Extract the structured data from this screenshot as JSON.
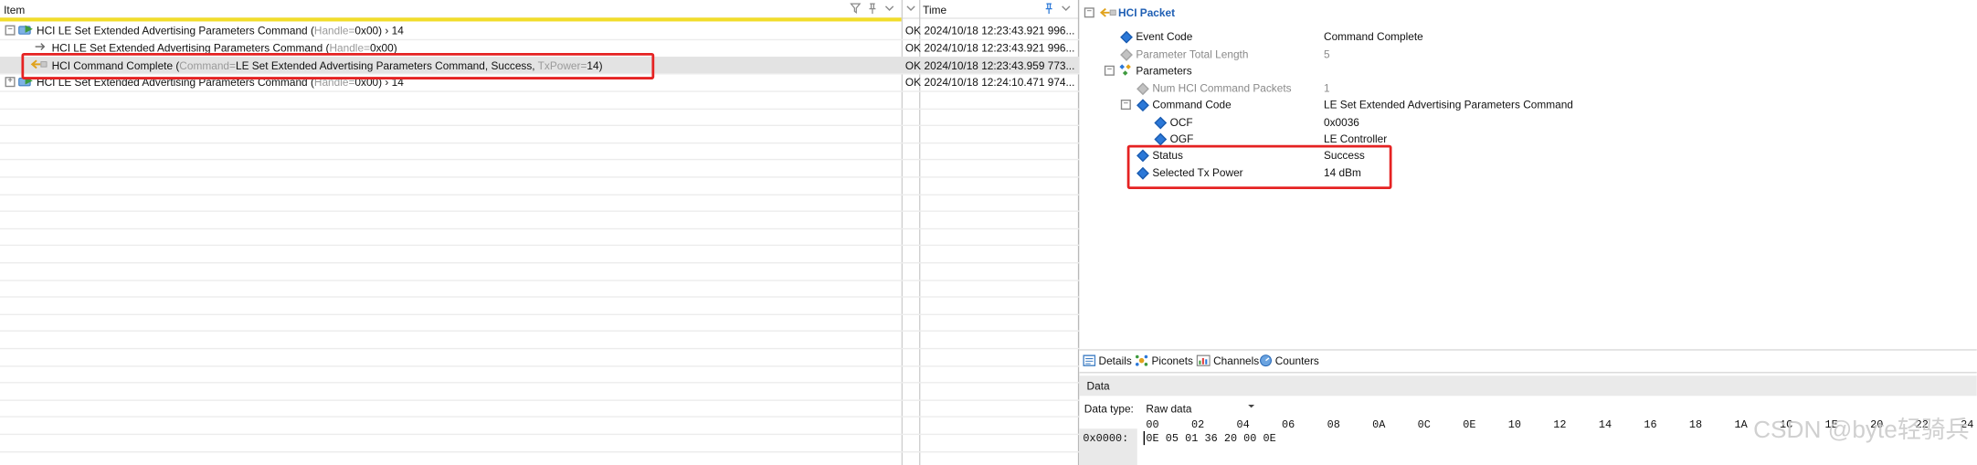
{
  "list_header": {
    "item": "Item",
    "status_col": "",
    "time": "Time"
  },
  "rows": [
    {
      "name": "HCI LE Set Extended Advertising Parameters Command",
      "open_paren": " (",
      "field1_key": "Handle",
      "field1_eq": "=",
      "field1_val": "0x00)",
      "tail": " › 14",
      "status": "OK",
      "time": "2024/10/18 12:23:43.921 996..."
    },
    {
      "name": "HCI LE Set Extended Advertising Parameters Command",
      "open_paren": " (",
      "field1_key": "Handle",
      "field1_eq": "=",
      "field1_val": "0x00)",
      "tail": "",
      "status": "OK",
      "time": "2024/10/18 12:23:43.921 996..."
    },
    {
      "name": "HCI Command Complete",
      "open_paren": " (",
      "field1_key": "Command",
      "field1_eq": "=",
      "field1_val": "LE Set Extended Advertising Parameters Command, Success, ",
      "field2_key": "TxPower",
      "field2_eq": "=",
      "field2_val": "14)",
      "tail": "",
      "status": "OK",
      "time": "2024/10/18 12:23:43.959 773..."
    },
    {
      "name": "HCI LE Set Extended Advertising Parameters Command",
      "open_paren": " (",
      "field1_key": "Handle",
      "field1_eq": "=",
      "field1_val": "0x00)",
      "tail": " › 14",
      "status": "OK",
      "time": "2024/10/18 12:24:10.471 974..."
    }
  ],
  "details": {
    "title": "HCI Packet",
    "event_code_label": "Event Code",
    "event_code_value": "Command Complete",
    "param_len_label": "Parameter Total Length",
    "param_len_value": "5",
    "parameters_label": "Parameters",
    "num_packets_label": "Num HCI Command Packets",
    "num_packets_value": "1",
    "command_code_label": "Command Code",
    "command_code_value": "LE Set Extended Advertising Parameters Command",
    "ocf_label": "OCF",
    "ocf_value": "0x0036",
    "ogf_label": "OGF",
    "ogf_value": "LE Controller",
    "status_label": "Status",
    "status_value": "Success",
    "txpower_label": "Selected Tx Power",
    "txpower_value": "14 dBm"
  },
  "tabs": [
    {
      "label": "Details"
    },
    {
      "label": "Piconets"
    },
    {
      "label": "Channels"
    },
    {
      "label": "Counters"
    }
  ],
  "data_panel": {
    "title": "Data",
    "type_label": "Data type:",
    "type_value": "Raw data",
    "offsets": [
      "00",
      "02",
      "04",
      "06",
      "08",
      "0A",
      "0C",
      "0E",
      "10",
      "12",
      "14",
      "16",
      "18",
      "1A",
      "1C",
      "1E",
      "20",
      "22",
      "24"
    ],
    "address": "0x0000:",
    "bytes": "0E 05 01 36 20 00 0E"
  },
  "watermark": "CSDN @byte轻骑兵",
  "colors": {
    "highlight_yellow": "#f2dd2a",
    "annotation_red": "#e52222",
    "selected_row": "#e3e3e3",
    "link_blue": "#1f5fb4"
  }
}
